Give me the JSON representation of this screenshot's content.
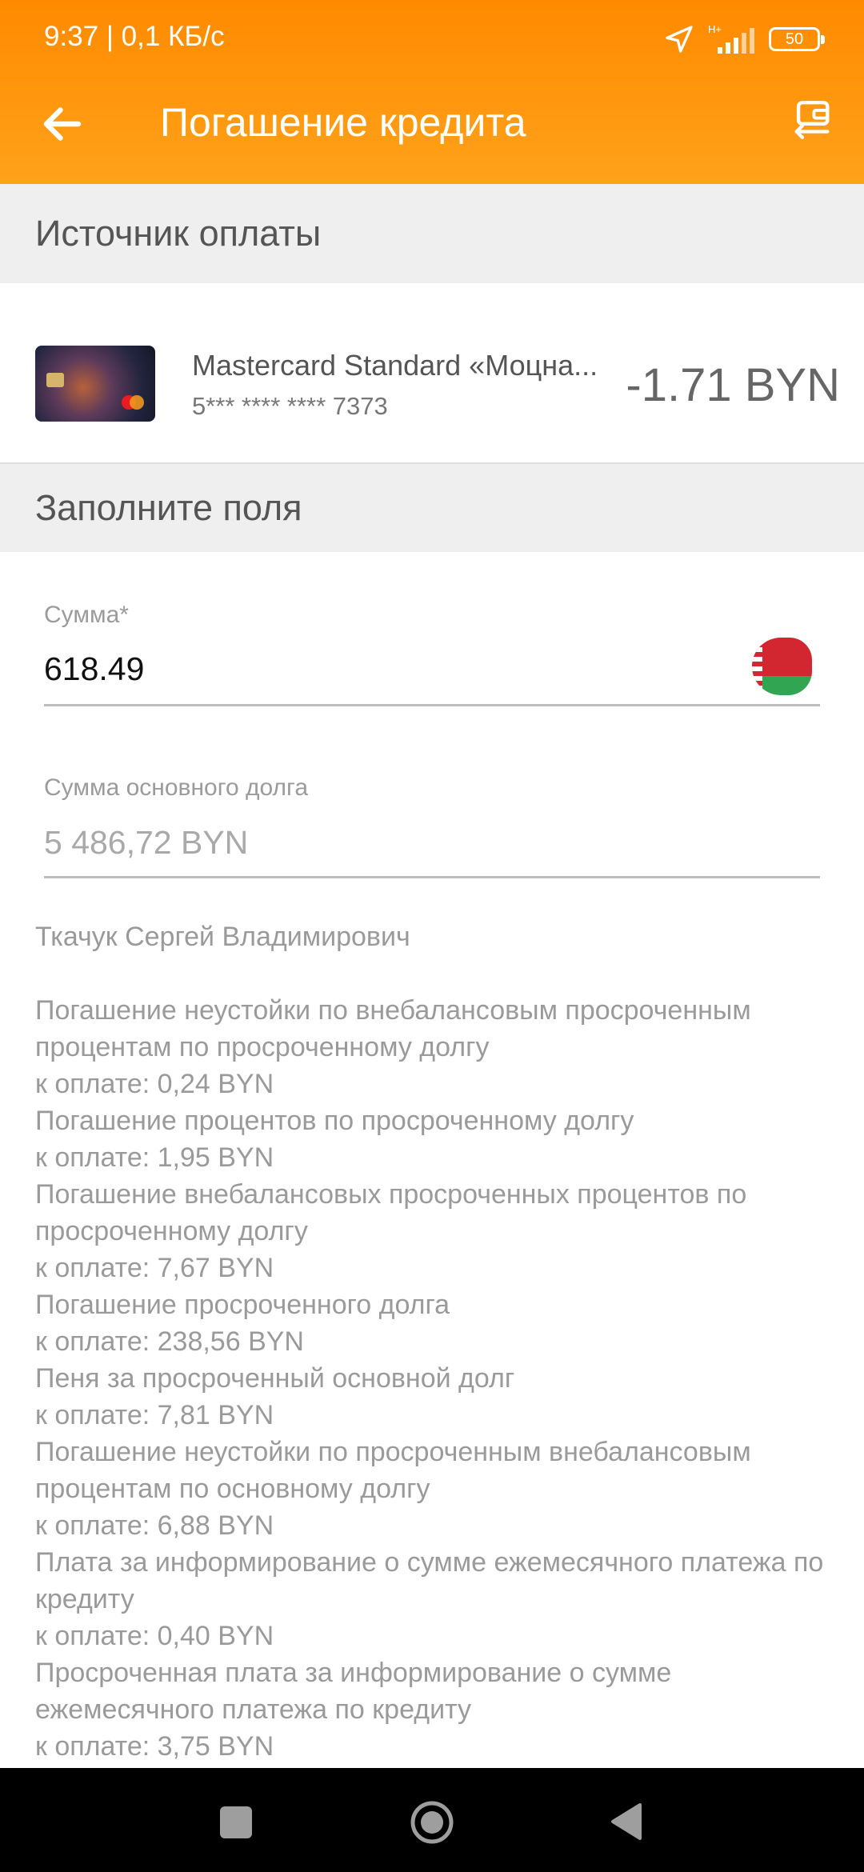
{
  "status_bar": {
    "time_speed": "9:37 | 0,1 КБ/с",
    "network": "H+",
    "battery": "50"
  },
  "header": {
    "title": "Погашение кредита",
    "icons": {
      "back": "arrow-left-icon",
      "action": "wallet-transfer-icon"
    }
  },
  "payment_source": {
    "section_title": "Источник оплаты",
    "card_name": "Mastercard Standard «Моцна...",
    "card_number": "5*** **** **** 7373",
    "balance": "-1.71 BYN"
  },
  "fields_section": {
    "title": "Заполните поля",
    "amount": {
      "label": "Сумма*",
      "value": "618.49",
      "currency_icon": "belarus-flag-icon"
    },
    "principal": {
      "label": "Сумма основного долга",
      "value": "5 486,72 BYN"
    }
  },
  "details": {
    "holder": "Ткачук Сергей Владимирович",
    "lines": [
      "Погашение неустойки по внебалансовым просроченным процентам по просроченному долгу",
      "к оплате: 0,24 BYN",
      "Погашение процентов по просроченному долгу",
      "к оплате: 1,95 BYN",
      "Погашение внебалансовых просроченных процентов по просроченному долгу",
      "к оплате: 7,67 BYN",
      "Погашение просроченного долга",
      "к оплате: 238,56 BYN",
      "Пеня за просроченный основной долг",
      "к оплате: 7,81 BYN",
      "Погашение неустойки по просроченным внебалансовым процентам по основному долгу",
      "к оплате: 6,88 BYN",
      "Плата за информирование о сумме ежемесячного платежа по кредиту",
      "к оплате: 0,40 BYN",
      "Просроченная плата за информирование о сумме ежемесячного платежа по кредиту",
      "к оплате: 3,75 BYN"
    ]
  },
  "colors": {
    "accent": "#ff8a00",
    "section_bg": "#efefef",
    "muted_text": "#9a9a9a"
  }
}
